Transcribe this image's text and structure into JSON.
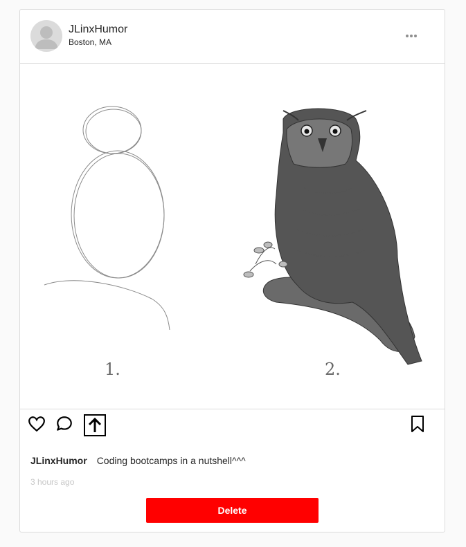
{
  "post": {
    "username": "JLinxHumor",
    "location": "Boston, MA",
    "caption_user": "JLinxHumor",
    "caption_text": "Coding bootcamps in a nutshell^^^",
    "timestamp": "3 hours ago",
    "delete_label": "Delete"
  },
  "image": {
    "step1_label": "1.",
    "step2_label": "2."
  },
  "icons": {
    "more": "ellipsis-icon",
    "like": "heart-icon",
    "comment": "comment-icon",
    "share": "share-upload-icon",
    "save": "bookmark-icon",
    "avatar": "user-placeholder-icon"
  },
  "colors": {
    "delete_button": "#ff0000",
    "border": "#dbdbdb",
    "timestamp": "#c7c7c7"
  }
}
